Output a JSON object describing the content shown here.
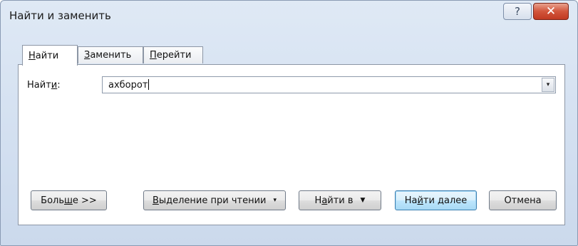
{
  "window": {
    "title": "Найти и заменить",
    "help_label": "?",
    "close_label": "✕"
  },
  "tabs": [
    {
      "prefix": "",
      "accel": "Н",
      "rest": "айти"
    },
    {
      "prefix": "",
      "accel": "З",
      "rest": "аменить"
    },
    {
      "prefix": "",
      "accel": "П",
      "rest": "ерейти"
    }
  ],
  "find": {
    "label_prefix": "Найт",
    "label_accel": "и",
    "label_suffix": ":",
    "value": "ахборот",
    "dropdown_icon": "▾"
  },
  "buttons": {
    "more": {
      "prefix": "Боль",
      "accel": "ш",
      "rest": "е >>"
    },
    "reading_highlight": {
      "prefix": "",
      "accel": "В",
      "rest": "ыделение при чтении",
      "arrow": "▾"
    },
    "find_in": {
      "prefix": "Н",
      "accel": "а",
      "rest": "йти в",
      "arrow": "▼"
    },
    "find_next": {
      "prefix": "На",
      "accel": "й",
      "rest": "ти далее"
    },
    "cancel": "Отмена"
  }
}
